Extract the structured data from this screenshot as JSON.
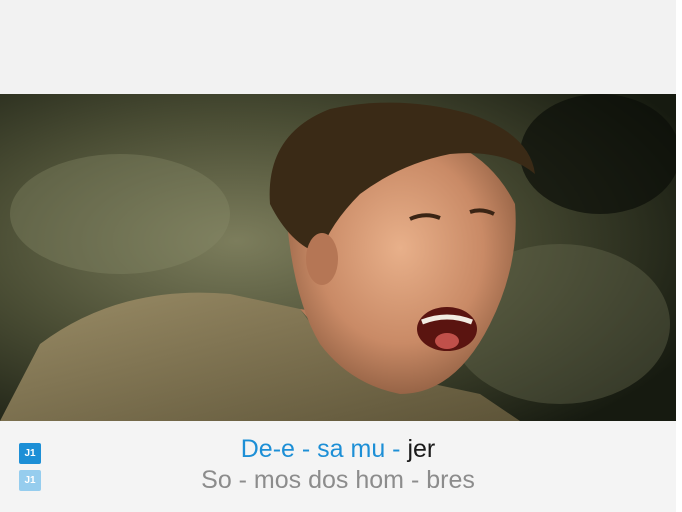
{
  "video": {
    "description_icon": "music-video-frame"
  },
  "lyrics": {
    "player_badge_1": "J1",
    "player_badge_2": "J1",
    "current_line_sung": "De-e - sa mu - ",
    "current_line_unsung": "jer",
    "next_line": "So - mos dos hom - bres"
  },
  "colors": {
    "highlight": "#1d8fd6",
    "badge_active": "#1d8fd6",
    "badge_inactive": "#96cdee",
    "next_line": "#8c8c8c"
  }
}
